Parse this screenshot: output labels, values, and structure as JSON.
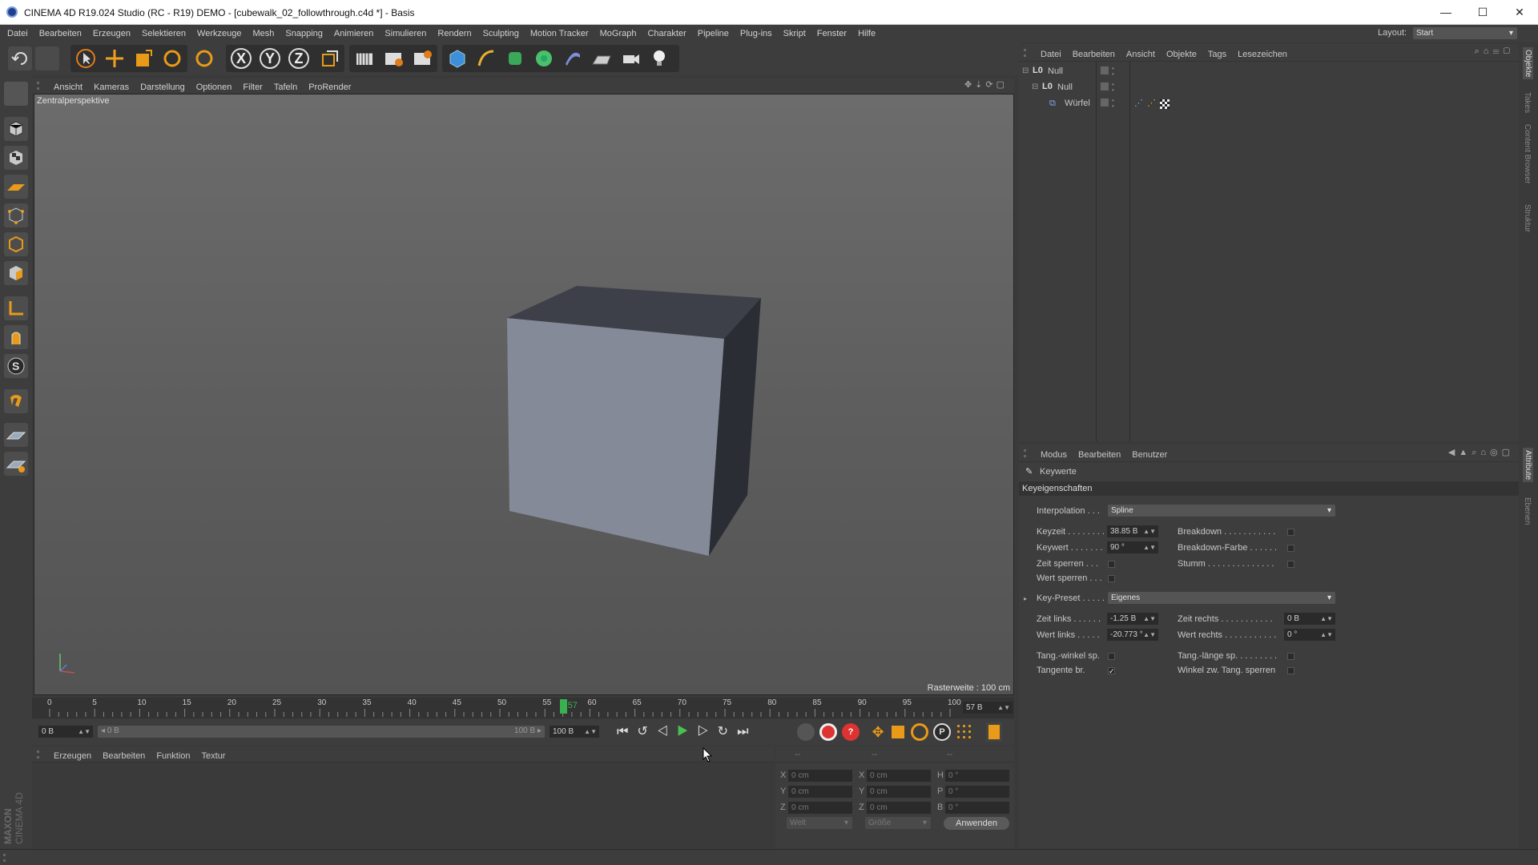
{
  "window": {
    "title": "CINEMA 4D R19.024 Studio (RC - R19) DEMO - [cubewalk_02_followthrough.c4d *] - Basis",
    "minimize": "—",
    "maximize": "☐",
    "close": "✕"
  },
  "menubar": {
    "items": [
      "Datei",
      "Bearbeiten",
      "Erzeugen",
      "Selektieren",
      "Werkzeuge",
      "Mesh",
      "Snapping",
      "Animieren",
      "Simulieren",
      "Rendern",
      "Sculpting",
      "Motion Tracker",
      "MoGraph",
      "Charakter",
      "Pipeline",
      "Plug-ins",
      "Skript",
      "Fenster",
      "Hilfe"
    ],
    "layout_label": "Layout:",
    "layout_value": "Start"
  },
  "toolbar": {
    "axis_x": "X",
    "axis_y": "Y",
    "axis_z": "Z"
  },
  "viewport": {
    "menu": [
      "Ansicht",
      "Kameras",
      "Darstellung",
      "Optionen",
      "Filter",
      "Tafeln",
      "ProRender"
    ],
    "camera_label": "Zentralperspektive",
    "grid_label": "Rasterweite : 100 cm"
  },
  "timeline": {
    "ticks": [
      "0",
      "5",
      "10",
      "15",
      "20",
      "25",
      "30",
      "35",
      "40",
      "45",
      "50",
      "55",
      "60",
      "65",
      "70",
      "75",
      "80",
      "85",
      "90",
      "95",
      "100"
    ],
    "current_frame": "57",
    "frame_field": "57 B",
    "current_fraction": 0.57
  },
  "playbar": {
    "start": "0 B",
    "range_start": "0 B",
    "range_end": "100 B",
    "end": "100 B"
  },
  "material_panel": {
    "menu": [
      "Erzeugen",
      "Bearbeiten",
      "Funktion",
      "Textur"
    ]
  },
  "coord_panel": {
    "header": [
      "--",
      "--",
      "--"
    ],
    "rows": [
      {
        "l1": "X",
        "v1": "0 cm",
        "l2": "X",
        "v2": "0 cm",
        "l3": "H",
        "v3": "0 °"
      },
      {
        "l1": "Y",
        "v1": "0 cm",
        "l2": "Y",
        "v2": "0 cm",
        "l3": "P",
        "v3": "0 °"
      },
      {
        "l1": "Z",
        "v1": "0 cm",
        "l2": "Z",
        "v2": "0 cm",
        "l3": "B",
        "v3": "0 °"
      }
    ],
    "mode1": "Welt",
    "mode2": "Größe",
    "apply": "Anwenden"
  },
  "object_panel": {
    "menu": [
      "Datei",
      "Bearbeiten",
      "Ansicht",
      "Objekte",
      "Tags",
      "Lesezeichen"
    ],
    "objects": [
      {
        "name": "Null"
      },
      {
        "name": "Null"
      },
      {
        "name": "Würfel"
      }
    ]
  },
  "attr_panel": {
    "menu": [
      "Modus",
      "Bearbeiten",
      "Benutzer"
    ],
    "title": "Keywerte",
    "section": "Keyeigenschaften",
    "interpolation_label": "Interpolation . . .",
    "interpolation_value": "Spline",
    "keyzeit_label": "Keyzeit . . . . . . . .",
    "keyzeit_value": "38.85 B",
    "keywert_label": "Keywert . . . . . . .",
    "keywert_value": "90 °",
    "zeit_sperren_label": "Zeit sperren . . .",
    "wert_sperren_label": "Wert sperren . . .",
    "breakdown_label": "Breakdown . . . . . . . . . . .",
    "breakdown_farbe_label": "Breakdown-Farbe . . . . . .",
    "stumm_label": "Stumm . . . . . . . . . . . . . .",
    "key_preset_label": "Key-Preset . . . . .",
    "key_preset_value": "Eigenes",
    "zeit_links_label": "Zeit links . . . . . .",
    "zeit_links_value": "-1.25 B",
    "wert_links_label": "Wert links . . . . .",
    "wert_links_value": "-20.773 °",
    "zeit_rechts_label": "Zeit rechts . . . . . . . . . . .",
    "zeit_rechts_value": "0 B",
    "wert_rechts_label": "Wert rechts . . . . . . . . . . .",
    "wert_rechts_value": "0 °",
    "tang_winkel_label": "Tang.-winkel sp.",
    "tangente_br_label": "Tangente br.",
    "tang_laenge_label": "Tang.-länge sp. . . . . . . . .",
    "winkel_zw_label": "Winkel zw. Tang. sperren"
  },
  "right_tabs": [
    "Objekte",
    "Takes",
    "Content Browser",
    "Struktur",
    "Attribute",
    "Ebenen"
  ],
  "branding": {
    "maxon": "MAXON",
    "c4d": "CINEMA 4D"
  }
}
